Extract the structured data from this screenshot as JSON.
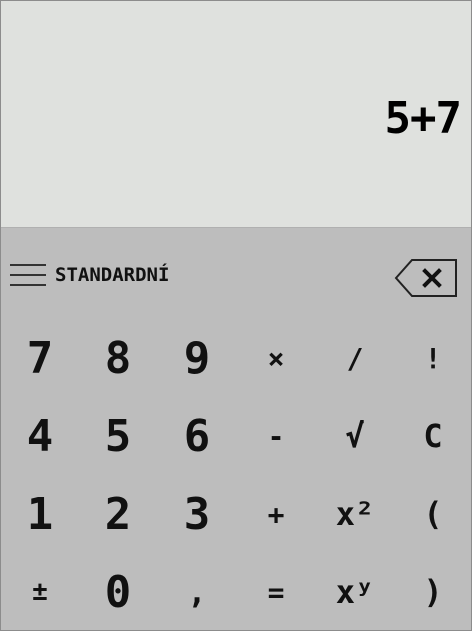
{
  "display": {
    "expression": "5+7"
  },
  "toolbar": {
    "mode_label": "STANDARDNÍ"
  },
  "keypad": {
    "rows": [
      [
        "7",
        "8",
        "9",
        "×",
        "/",
        "!"
      ],
      [
        "4",
        "5",
        "6",
        "-",
        "√",
        "C"
      ],
      [
        "1",
        "2",
        "3",
        "+",
        "x²",
        "("
      ],
      [
        "±",
        "0",
        ",",
        "=",
        "xʸ",
        ")"
      ]
    ]
  },
  "icons": {
    "menu": "hamburger-menu-icon",
    "backspace": "backspace-icon"
  },
  "colors": {
    "display_background": "#dfe1de",
    "keypad_background": "#bdbdbd",
    "text": "#111111"
  }
}
